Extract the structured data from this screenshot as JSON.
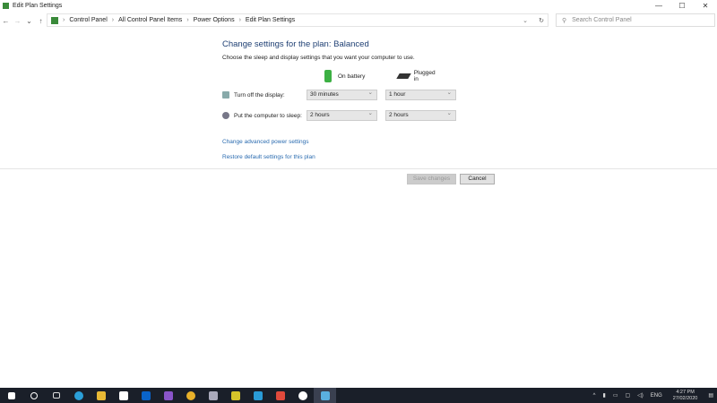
{
  "window": {
    "title": "Edit Plan Settings",
    "minimize": "—",
    "maximize": "☐",
    "close": "✕"
  },
  "address": {
    "back": "←",
    "forward": "→",
    "recent": "⌄",
    "up": "↑",
    "crumbs": [
      "Control Panel",
      "All Control Panel Items",
      "Power Options",
      "Edit Plan Settings"
    ],
    "refresh": "↻",
    "search_placeholder": "Search Control Panel",
    "dropdown": "⌄"
  },
  "main": {
    "title": "Change settings for the plan: Balanced",
    "subtitle": "Choose the sleep and display settings that you want your computer to use.",
    "on_battery": "On battery",
    "plugged_in": "Plugged in",
    "display_label": "Turn off the display:",
    "display_battery": "30 minutes",
    "display_plugged": "1 hour",
    "sleep_label": "Put the computer to sleep:",
    "sleep_battery": "2 hours",
    "sleep_plugged": "2 hours",
    "advanced_link": "Change advanced power settings",
    "restore_link": "Restore default settings for this plan",
    "save": "Save changes",
    "cancel": "Cancel"
  },
  "tray": {
    "lang": "ENG",
    "time": "4:27 PM",
    "date": "27/02/2020"
  }
}
